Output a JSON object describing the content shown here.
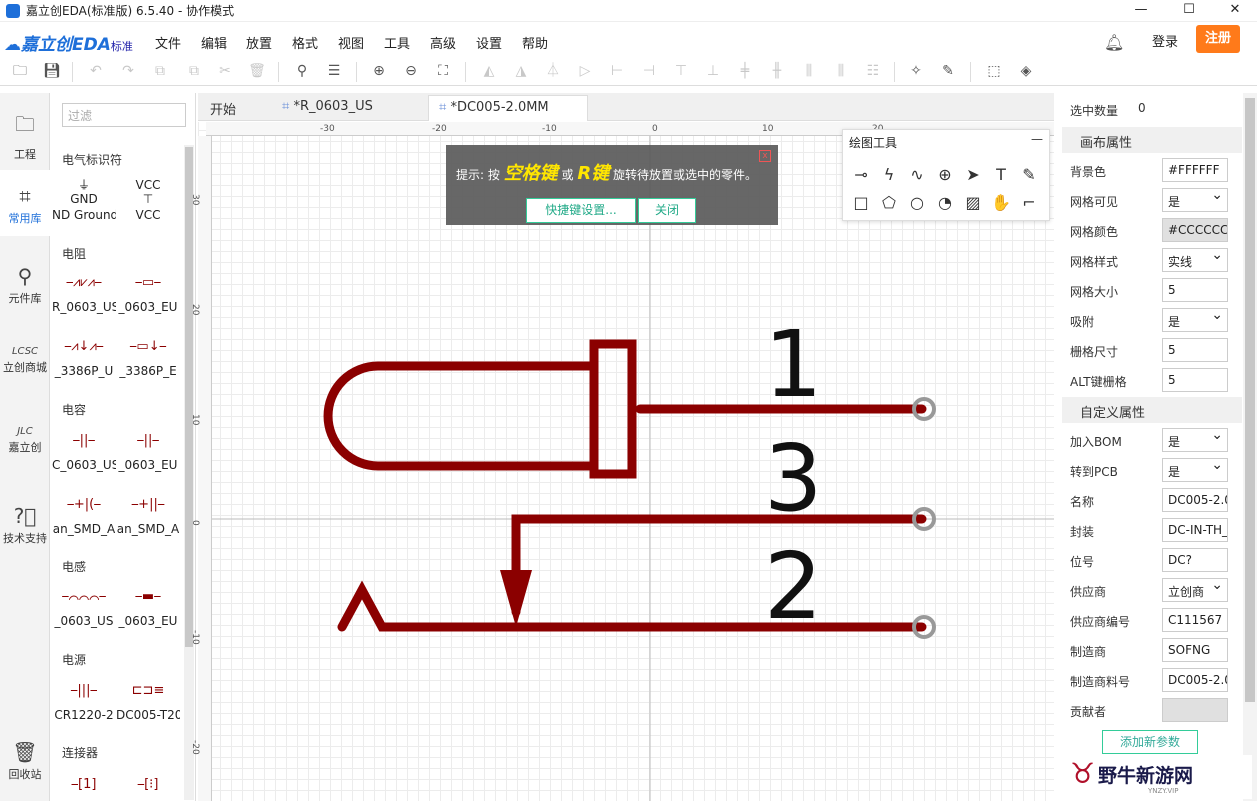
{
  "window": {
    "title": "嘉立创EDA(标准版) 6.5.40 - 协作模式",
    "minimize": "—",
    "maximize": "☐",
    "close": "✕"
  },
  "brand": {
    "name": "嘉立创EDA",
    "edition": "标准"
  },
  "menu": [
    "文件",
    "编辑",
    "放置",
    "格式",
    "视图",
    "工具",
    "高级",
    "设置",
    "帮助"
  ],
  "account": {
    "login": "登录",
    "register": "注册"
  },
  "left_nav": [
    "工程",
    "常用库",
    "元件库",
    "立创商城",
    "嘉立创",
    "技术支持",
    "回收站"
  ],
  "library": {
    "filter_placeholder": "过滤",
    "categories": [
      {
        "name": "电气标识符",
        "items": [
          "ND Ground",
          "VCC"
        ]
      },
      {
        "name": "电阻",
        "items": [
          "R_0603_US",
          "_0603_EU",
          "_3386P_U",
          "_3386P_E"
        ]
      },
      {
        "name": "电容",
        "items": [
          "C_0603_US",
          "_0603_EU",
          "an_SMD_A",
          "an_SMD_A"
        ]
      },
      {
        "name": "电感",
        "items": [
          "_0603_US",
          "_0603_EU"
        ]
      },
      {
        "name": "电源",
        "items": [
          "CR1220-2",
          "DC005-T20"
        ]
      },
      {
        "name": "连接器",
        "items": [
          "",
          ""
        ]
      }
    ],
    "symbol_text": {
      "gnd": "GND",
      "vcc": "VCC"
    }
  },
  "tabs": [
    {
      "label": "开始"
    },
    {
      "label": "*R_0603_US"
    },
    {
      "label": "*DC005-2.0MM"
    }
  ],
  "ruler": {
    "top": [
      "-30",
      "-20",
      "-10",
      "0",
      "10",
      "20"
    ],
    "left": [
      "30",
      "20",
      "10",
      "0",
      "-10",
      "-20"
    ]
  },
  "hint": {
    "prefix": "提示: 按 ",
    "key1": "空格键",
    "mid": " 或 ",
    "key2": "R键",
    "suffix": " 旋转待放置或选中的零件。",
    "shortcut_button": "快捷键设置...",
    "close_button": "关闭",
    "x": "x"
  },
  "drawing_tools": {
    "title": "绘图工具",
    "collapse": "—"
  },
  "schematic": {
    "pin_labels": [
      "1",
      "3",
      "2"
    ]
  },
  "properties": {
    "selected_count_label": "选中数量",
    "selected_count": "0",
    "canvas_section": "画布属性",
    "canvas": [
      {
        "label": "背景色",
        "value": "#FFFFFF",
        "type": "text"
      },
      {
        "label": "网格可见",
        "value": "是",
        "type": "select"
      },
      {
        "label": "网格颜色",
        "value": "#CCCCCC",
        "type": "gray"
      },
      {
        "label": "网格样式",
        "value": "实线",
        "type": "select"
      },
      {
        "label": "网格大小",
        "value": "5",
        "type": "text"
      },
      {
        "label": "吸附",
        "value": "是",
        "type": "select"
      },
      {
        "label": "栅格尺寸",
        "value": "5",
        "type": "text"
      },
      {
        "label": "ALT键栅格",
        "value": "5",
        "type": "text"
      }
    ],
    "custom_section": "自定义属性",
    "custom": [
      {
        "label": "加入BOM",
        "value": "是",
        "type": "select"
      },
      {
        "label": "转到PCB",
        "value": "是",
        "type": "select"
      },
      {
        "label": "名称",
        "value": "DC005-2.0",
        "type": "text"
      },
      {
        "label": "封装",
        "value": "DC-IN-TH_",
        "type": "text"
      },
      {
        "label": "位号",
        "value": "DC?",
        "type": "text"
      },
      {
        "label": "供应商",
        "value": "立创商",
        "type": "select"
      },
      {
        "label": "供应商编号",
        "value": "C111567",
        "type": "text"
      },
      {
        "label": "制造商",
        "value": "SOFNG",
        "type": "text"
      },
      {
        "label": "制造商料号",
        "value": "DC005-2.0",
        "type": "text"
      },
      {
        "label": "贡献者",
        "value": "",
        "type": "gray"
      }
    ],
    "add_param": "添加新参数"
  },
  "watermark": {
    "text": "野牛新游网",
    "sub": "YNZY.VIP"
  },
  "colors": {
    "wire": "#8b0000",
    "accent": "#1e6fd9",
    "register": "#ff7a1a"
  }
}
